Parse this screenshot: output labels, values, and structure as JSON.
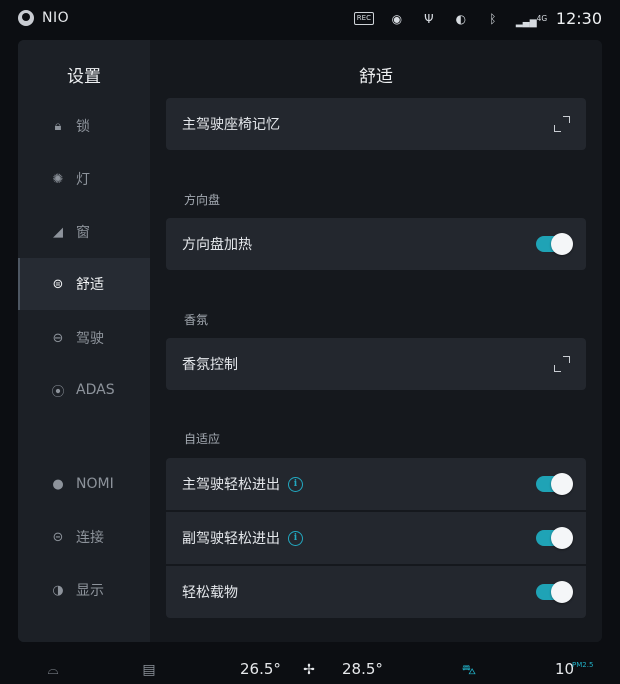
{
  "status": {
    "brand": "NIO",
    "signal": "4G",
    "time": "12:30",
    "icons": [
      "rec-icon",
      "camera-icon",
      "usb-icon",
      "wireless-charge-icon",
      "bluetooth-icon",
      "signal-icon"
    ]
  },
  "sidebar": {
    "title": "设置",
    "items": [
      {
        "label": "锁",
        "icon": "lock-icon"
      },
      {
        "label": "灯",
        "icon": "light-icon"
      },
      {
        "label": "窗",
        "icon": "window-icon"
      },
      {
        "label": "舒适",
        "icon": "seat-comfort-icon",
        "active": true
      },
      {
        "label": "驾驶",
        "icon": "steering-wheel-icon"
      },
      {
        "label": "ADAS",
        "icon": "adas-icon"
      },
      {
        "label": "NOMI",
        "icon": "nomi-icon"
      },
      {
        "label": "连接",
        "icon": "link-icon"
      },
      {
        "label": "显示",
        "icon": "display-icon"
      }
    ]
  },
  "content": {
    "title": "舒适",
    "seat_memory": "主驾驶座椅记忆",
    "sections": {
      "steering": "方向盘",
      "fragrance": "香氛",
      "adaptive": "自适应"
    },
    "steering_heat": {
      "label": "方向盘加热",
      "on": true
    },
    "fragrance_control": "香氛控制",
    "driver_easy": {
      "label": "主驾驶轻松进出",
      "on": true
    },
    "passenger_easy": {
      "label": "副驾驶轻松进出",
      "on": true
    },
    "easy_load": {
      "label": "轻松载物",
      "on": true
    }
  },
  "climate": {
    "left_temp": "26.5°",
    "right_temp": "28.5°",
    "pm_value": "10",
    "pm_label": "PM2.5"
  },
  "colors": {
    "accent": "#1fa3b6",
    "panel": "#1b1f25",
    "row": "#23272e"
  }
}
